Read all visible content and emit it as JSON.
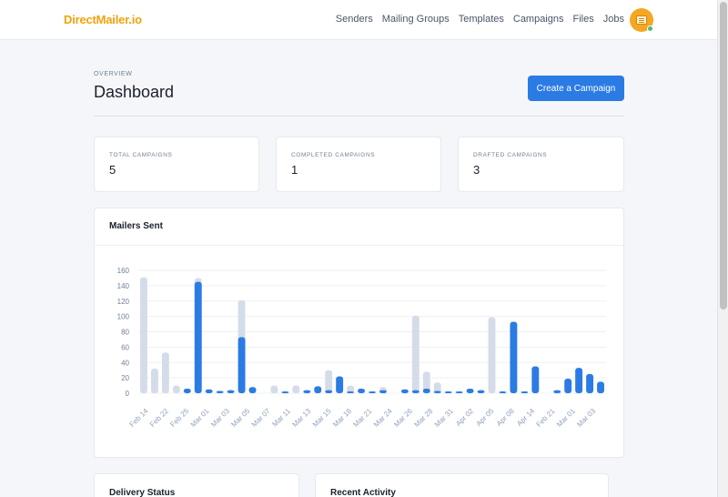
{
  "brand": "DirectMailer.io",
  "nav": {
    "items": [
      "Senders",
      "Mailing Groups",
      "Templates",
      "Campaigns",
      "Files",
      "Jobs"
    ]
  },
  "page": {
    "pretitle": "OVERVIEW",
    "title": "Dashboard",
    "create_button": "Create a Campaign"
  },
  "stats": [
    {
      "label": "TOTAL CAMPAIGNS",
      "value": "5"
    },
    {
      "label": "COMPLETED CAMPAIGNS",
      "value": "1"
    },
    {
      "label": "DRAFTED CAMPAIGNS",
      "value": "3"
    }
  ],
  "cards": {
    "delivery_status": "Delivery Status",
    "recent_activity": "Recent Activity"
  },
  "chart_data": {
    "type": "bar",
    "title": "Mailers Sent",
    "ylim": [
      0,
      160
    ],
    "yticks": [
      0,
      20,
      40,
      60,
      80,
      100,
      120,
      140,
      160
    ],
    "grid": true,
    "colors": {
      "primary": "#2b7be4",
      "secondary": "#d5dce9"
    },
    "x_labels": [
      "Feb 14",
      "Feb 22",
      "Feb 25",
      "Mar 01",
      "Mar 03",
      "Mar 05",
      "Mar 07",
      "Mar 11",
      "Mar 13",
      "Mar 15",
      "Mar 18",
      "Mar 21",
      "Mar 24",
      "Mar 26",
      "Mar 28",
      "Mar 31",
      "Apr 02",
      "Apr 05",
      "Apr 08",
      "Apr 14",
      "Feb 21",
      "Mar 01",
      "Mar 03"
    ],
    "series": [
      {
        "name": "",
        "values": [
          151,
          32,
          53,
          10,
          0,
          150,
          0,
          0,
          0,
          121,
          0,
          0,
          10,
          0,
          10,
          0,
          0,
          30,
          10,
          10,
          0,
          0,
          8,
          0,
          0,
          101,
          28,
          14,
          0,
          0,
          0,
          0,
          99,
          0,
          0,
          0,
          0,
          0
        ]
      },
      {
        "name": "",
        "values": [
          0,
          0,
          0,
          0,
          6,
          145,
          5,
          3,
          4,
          73,
          8,
          0,
          0,
          2,
          0,
          4,
          9,
          4,
          22,
          2,
          6,
          2,
          4,
          0,
          5,
          4,
          6,
          3,
          2,
          1,
          6,
          4,
          0,
          1,
          93,
          1,
          35,
          0,
          4,
          19,
          33,
          25,
          15
        ]
      }
    ]
  }
}
